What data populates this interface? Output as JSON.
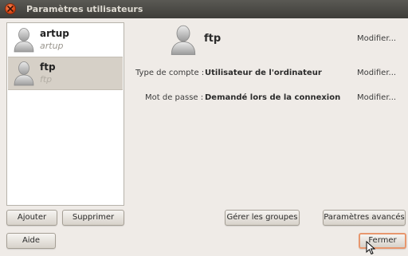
{
  "window": {
    "title": "Paramètres utilisateurs"
  },
  "users": [
    {
      "name": "artup",
      "login": "artup"
    },
    {
      "name": "ftp",
      "login": "ftp"
    }
  ],
  "details": {
    "name": "ftp",
    "modify_name": "Modifier...",
    "account_type_label": "Type de compte :",
    "account_type_value": "Utilisateur de l'ordinateur",
    "modify_account_type": "Modifier...",
    "password_label": "Mot de passe :",
    "password_value": "Demandé lors de la connexion",
    "modify_password": "Modifier..."
  },
  "buttons": {
    "add": "Ajouter",
    "delete": "Supprimer",
    "manage_groups": "Gérer les groupes",
    "advanced": "Paramètres avancés",
    "help": "Aide",
    "close": "Fermer"
  },
  "icons": {
    "close": "close-icon",
    "user": "user-avatar-icon",
    "cursor": "mouse-pointer-icon"
  },
  "colors": {
    "titlebar": "#3e3d39",
    "window_bg": "#efebe7",
    "close_button": "#dd4814",
    "selected_row": "#d6d0c7",
    "focus_ring": "#e7976e"
  }
}
